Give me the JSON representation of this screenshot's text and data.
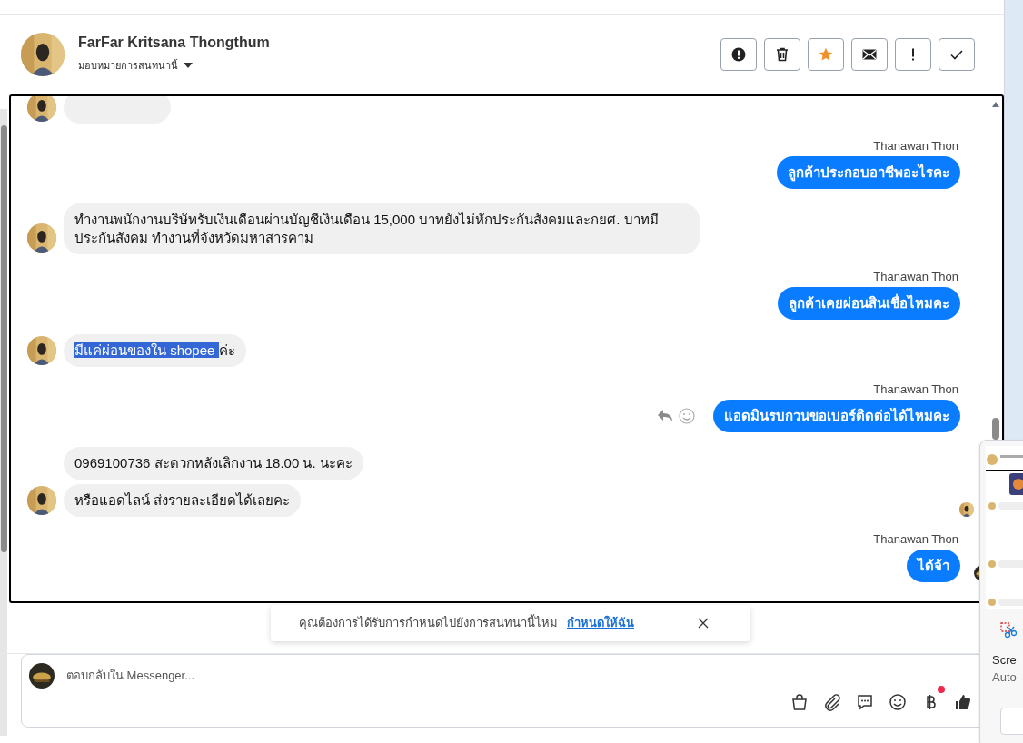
{
  "header": {
    "name": "FarFar Kritsana Thongthum",
    "assign_label": "มอบหมายการสนทนานี้",
    "actions": [
      {
        "kind": "spam",
        "on": false
      },
      {
        "kind": "delete",
        "on": false
      },
      {
        "kind": "star",
        "on": true
      },
      {
        "kind": "mail",
        "on": false
      },
      {
        "kind": "important",
        "on": false
      },
      {
        "kind": "done",
        "on": false
      }
    ]
  },
  "messages": [
    {
      "kind": "in",
      "cut_off": true,
      "avatar": true,
      "read_receipt": false,
      "reactions_bar": false
    },
    {
      "kind": "out",
      "cut_off": false,
      "sender": "Thanawan Thon",
      "text": "ลูกค้าประกอบอาชีพอะไรคะ",
      "read_receipt": false,
      "reactions_bar": false
    },
    {
      "kind": "in",
      "cut_off": false,
      "avatar": true,
      "text": "ทำงานพนักงานบริษัทรับเงินเดือนผ่านบัญชีเงินเดือน 15,000 บาทยังไม่หักประกันสังคมและกยศ. บาทมี ประกันสังคม ทำงานที่จังหวัดมหาสารคาม",
      "read_receipt": false,
      "reactions_bar": false
    },
    {
      "kind": "out",
      "cut_off": false,
      "sender": "Thanawan Thon",
      "text": "ลูกค้าเคยผ่อนสินเชื่อไหมคะ",
      "read_receipt": false,
      "reactions_bar": false
    },
    {
      "kind": "in",
      "cut_off": false,
      "avatar": true,
      "text_parts": [
        {
          "text": "มีแค่ผ่อนของใน shopee ",
          "highlighted": true
        },
        {
          "text": "ค่ะ",
          "highlighted": false
        }
      ],
      "read_receipt": false,
      "reactions_bar": false
    },
    {
      "kind": "out",
      "cut_off": false,
      "sender": "Thanawan Thon",
      "text": "แอดมินรบกวนขอเบอร์ติดต่อได้ไหมคะ",
      "read_receipt": false,
      "reactions_bar": true
    },
    {
      "kind": "in",
      "cut_off": false,
      "avatar": false,
      "text": "0969100736 สะดวกหลังเลิกงาน 18.00 น. นะคะ",
      "read_receipt": false,
      "reactions_bar": false
    },
    {
      "kind": "in",
      "cut_off": false,
      "avatar": true,
      "text": "หรือแอดไลน์ ส่งรายละเอียดได้เลยคะ",
      "read_receipt": true,
      "reactions_bar": false
    },
    {
      "kind": "out",
      "cut_off": false,
      "sender": "Thanawan Thon",
      "text": "ได้จ้า",
      "read_receipt": true,
      "reactions_bar": false
    }
  ],
  "notice": {
    "text": "คุณต้องการได้รับการกำหนดไปยังการสนทนานี้ไหม",
    "link": "กำหนดให้ฉัน"
  },
  "composer": {
    "placeholder": "ตอบกลับใน Messenger...",
    "tools": [
      {
        "kind": "bag",
        "badge": false
      },
      {
        "kind": "clip",
        "badge": false
      },
      {
        "kind": "chat",
        "badge": false
      },
      {
        "kind": "smile",
        "badge": false
      },
      {
        "kind": "baht",
        "badge": true
      },
      {
        "kind": "like",
        "badge": false
      }
    ]
  },
  "snip_popup": {
    "title": "Scre",
    "subtitle": "Auto"
  }
}
